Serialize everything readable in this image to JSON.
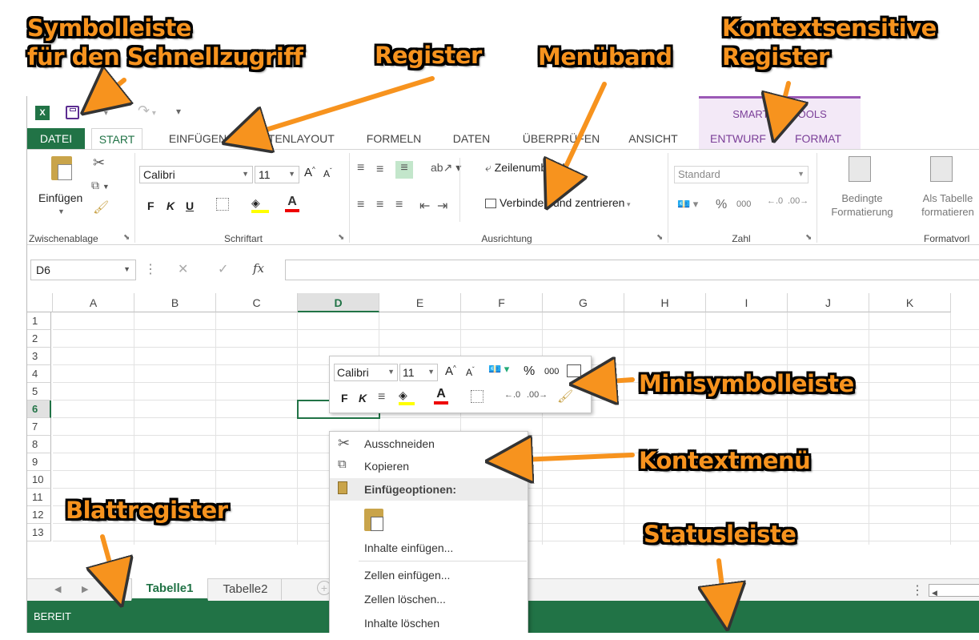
{
  "annotations": {
    "qat_line1": "Symbolleiste",
    "qat_line2": "für den Schnellzugriff",
    "register": "Register",
    "menueband": "Menüband",
    "kontext_line1": "Kontextsensitive",
    "kontext_line2": "Register",
    "minisymbolleiste": "Minisymbolleiste",
    "kontextmenue": "Kontextmenü",
    "blattregister": "Blattregister",
    "statusleiste": "Statusleiste"
  },
  "excel": {
    "contextual_group": "SMARTART-TOOLS",
    "tabs": [
      "DATEI",
      "START",
      "EINFÜGEN",
      "SEITENLAYOUT",
      "FORMELN",
      "DATEN",
      "ÜBERPRÜFEN",
      "ANSICHT",
      "ENTWURF",
      "FORMAT"
    ],
    "clipboard": {
      "paste": "Einfügen",
      "label": "Zwischenablage"
    },
    "font": {
      "name": "Calibri",
      "size": "11",
      "bold": "F",
      "italic": "K",
      "underline": "U",
      "label": "Schriftart"
    },
    "alignment": {
      "wrap": "Zeilenumbruch",
      "merge": "Verbinden und zentrieren",
      "label": "Ausrichtung"
    },
    "number": {
      "format": "Standard",
      "percent": "%",
      "thousands": "000",
      "label": "Zahl"
    },
    "styles": {
      "cond1": "Bedingte",
      "cond2": "Formatierung",
      "table1": "Als Tabelle",
      "table2": "formatieren",
      "label": "Formatvorl"
    },
    "namebox": "D6",
    "fx": "fx",
    "columns": [
      "A",
      "B",
      "C",
      "D",
      "E",
      "F",
      "G",
      "H",
      "I",
      "J",
      "K"
    ],
    "rows": [
      "1",
      "2",
      "3",
      "4",
      "5",
      "6",
      "7",
      "8",
      "9",
      "10",
      "11",
      "12",
      "13"
    ],
    "sheets": [
      "Tabelle1",
      "Tabelle2"
    ],
    "status": "BEREIT",
    "mini": {
      "font": "Calibri",
      "size": "11",
      "percent": "%",
      "thousands": "000",
      "bold": "F",
      "italic": "K"
    },
    "context_menu": {
      "cut": "Ausschneiden",
      "copy": "Kopieren",
      "paste_options": "Einfügeoptionen:",
      "paste_special": "Inhalte einfügen...",
      "insert_cells": "Zellen einfügen...",
      "delete_cells": "Zellen löschen...",
      "clear_contents": "Inhalte löschen"
    }
  },
  "colors": {
    "accent": "#217346",
    "annotation": "#f7931e",
    "contextual": "#9b59b6"
  }
}
